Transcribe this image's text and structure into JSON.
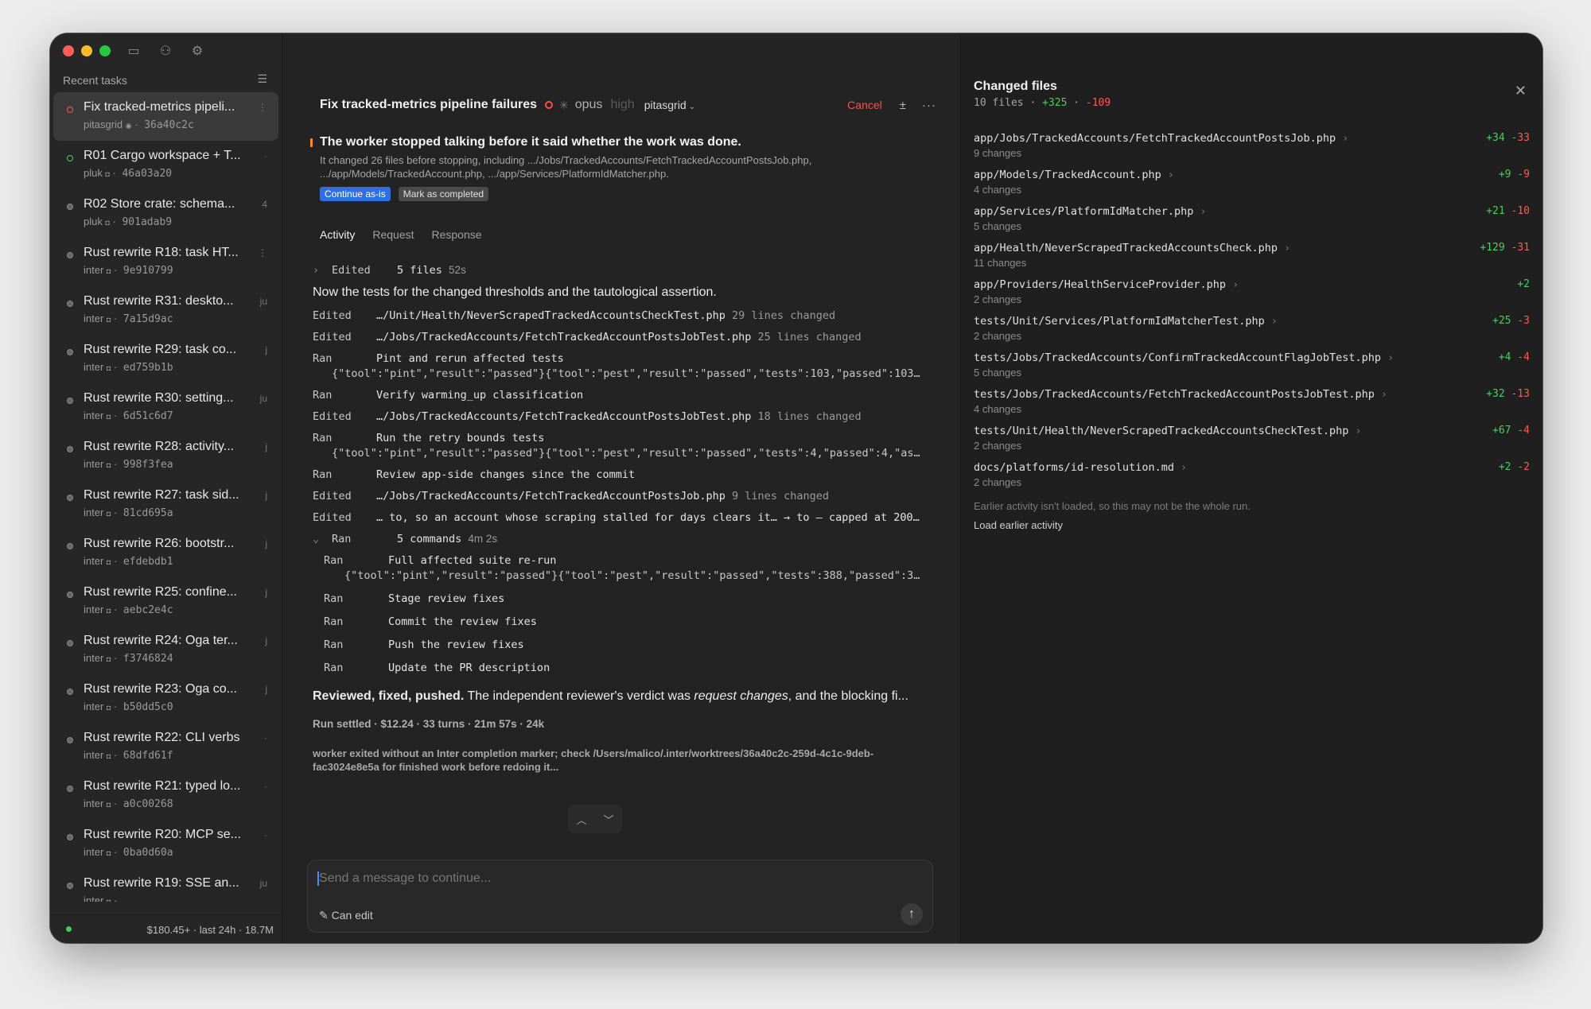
{
  "sidebar": {
    "recent_label": "Recent tasks",
    "tasks": [
      {
        "title": "Fix tracked-metrics pipeli...",
        "project": "pitasgrid",
        "hash": "36a40c2c",
        "status": "red",
        "right": "⋮",
        "icon": "◉"
      },
      {
        "title": "R01 Cargo workspace + T...",
        "project": "pluk",
        "hash": "46a03a20",
        "status": "green",
        "right": "·",
        "icon": "◘"
      },
      {
        "title": "R02 Store crate: schema...",
        "project": "pluk",
        "hash": "901adab9",
        "status": "gray",
        "right": "4",
        "icon": "◘"
      },
      {
        "title": "Rust rewrite R18: task HT...",
        "project": "inter",
        "hash": "9e910799",
        "status": "gray",
        "right": "⋮",
        "icon": "◘"
      },
      {
        "title": "Rust rewrite R31: deskto...",
        "project": "inter",
        "hash": "7a15d9ac",
        "status": "gray",
        "right": "ju",
        "icon": "◘"
      },
      {
        "title": "Rust rewrite R29: task co...",
        "project": "inter",
        "hash": "ed759b1b",
        "status": "gray",
        "right": "j",
        "icon": "◘"
      },
      {
        "title": "Rust rewrite R30: setting...",
        "project": "inter",
        "hash": "6d51c6d7",
        "status": "gray",
        "right": "ju",
        "icon": "◘"
      },
      {
        "title": "Rust rewrite R28: activity...",
        "project": "inter",
        "hash": "998f3fea",
        "status": "gray",
        "right": "j",
        "icon": "◘"
      },
      {
        "title": "Rust rewrite R27: task sid...",
        "project": "inter",
        "hash": "81cd695a",
        "status": "gray",
        "right": "j",
        "icon": "◘"
      },
      {
        "title": "Rust rewrite R26: bootstr...",
        "project": "inter",
        "hash": "efdebdb1",
        "status": "gray",
        "right": "j",
        "icon": "◘"
      },
      {
        "title": "Rust rewrite R25: confine...",
        "project": "inter",
        "hash": "aebc2e4c",
        "status": "gray",
        "right": "j",
        "icon": "◘"
      },
      {
        "title": "Rust rewrite R24: Oga ter...",
        "project": "inter",
        "hash": "f3746824",
        "status": "gray",
        "right": "j",
        "icon": "◘"
      },
      {
        "title": "Rust rewrite R23: Oga co...",
        "project": "inter",
        "hash": "b50dd5c0",
        "status": "gray",
        "right": "j",
        "icon": "◘"
      },
      {
        "title": "Rust rewrite R22: CLI verbs",
        "project": "inter",
        "hash": "68dfd61f",
        "status": "gray",
        "right": "·",
        "icon": "◘"
      },
      {
        "title": "Rust rewrite R21: typed lo...",
        "project": "inter",
        "hash": "a0c00268",
        "status": "gray",
        "right": "·",
        "icon": "◘"
      },
      {
        "title": "Rust rewrite R20: MCP se...",
        "project": "inter",
        "hash": "0ba0d60a",
        "status": "gray",
        "right": "·",
        "icon": "◘"
      },
      {
        "title": "Rust rewrite R19: SSE an...",
        "project": "inter",
        "hash": "",
        "status": "gray",
        "right": "ju",
        "icon": "◘"
      }
    ],
    "footer_cost": "$180.45+ · last 24h · 18.7M"
  },
  "main": {
    "title": "Fix tracked-metrics pipeline failures",
    "model": "opus",
    "effort": "high",
    "project": "pitasgrid",
    "cancel": "Cancel",
    "plusminus": "±",
    "more": "···",
    "alert_title": "The worker stopped talking before it said whether the work was done.",
    "alert_body": "It changed 26 files before stopping, including .../Jobs/TrackedAccounts/FetchTrackedAccountPostsJob.php, .../app/Models/TrackedAccount.php, .../app/Services/PlatformIdMatcher.php.",
    "continue_btn": "Continue as-is",
    "mark_btn": "Mark as completed",
    "tabs": [
      "Activity",
      "Request",
      "Response"
    ],
    "group1": {
      "kind": "Edited",
      "text": "5 files",
      "time": "52s"
    },
    "prose1": "Now the tests for the changed thresholds and the tautological assertion.",
    "rows": [
      {
        "kind": "Edited",
        "what": "…/Unit/Health/NeverScrapedTrackedAccountsCheckTest.php",
        "extra": "29 lines changed",
        "sub": ""
      },
      {
        "kind": "Edited",
        "what": "…/Jobs/TrackedAccounts/FetchTrackedAccountPostsJobTest.php",
        "extra": "25 lines changed",
        "sub": ""
      },
      {
        "kind": "Ran",
        "what": "Pint and rerun affected tests",
        "extra": "",
        "sub": "{\"tool\":\"pint\",\"result\":\"passed\"}{\"tool\":\"pest\",\"result\":\"passed\",\"tests\":103,\"passed\":103…"
      },
      {
        "kind": "Ran",
        "what": "Verify warming_up classification",
        "extra": "",
        "sub": ""
      },
      {
        "kind": "Edited",
        "what": "…/Jobs/TrackedAccounts/FetchTrackedAccountPostsJobTest.php",
        "extra": "18 lines changed",
        "sub": ""
      },
      {
        "kind": "Ran",
        "what": "Run the retry bounds tests",
        "extra": "",
        "sub": "{\"tool\":\"pint\",\"result\":\"passed\"}{\"tool\":\"pest\",\"result\":\"passed\",\"tests\":4,\"passed\":4,\"as…"
      },
      {
        "kind": "Ran",
        "what": "Review app-side changes since the commit",
        "extra": "",
        "sub": ""
      },
      {
        "kind": "Edited",
        "what": "…/Jobs/TrackedAccounts/FetchTrackedAccountPostsJob.php",
        "extra": "9 lines changed",
        "sub": ""
      },
      {
        "kind": "Edited",
        "what": "… to, so an account whose scraping stalled for days clears it… → to — capped at 200…",
        "extra": "",
        "sub": ""
      }
    ],
    "group2": {
      "kind": "Ran",
      "text": "5 commands",
      "time": "4m 2s"
    },
    "nested": [
      {
        "kind": "Ran",
        "what": "Full affected suite re-run",
        "sub": "{\"tool\":\"pint\",\"result\":\"passed\"}{\"tool\":\"pest\",\"result\":\"passed\",\"tests\":388,\"passed\":3…"
      },
      {
        "kind": "Ran",
        "what": "Stage review fixes",
        "sub": ""
      },
      {
        "kind": "Ran",
        "what": "Commit the review fixes",
        "sub": ""
      },
      {
        "kind": "Ran",
        "what": "Push the review fixes",
        "sub": ""
      },
      {
        "kind": "Ran",
        "what": "Update the PR description",
        "sub": ""
      }
    ],
    "prose2_bold": "Reviewed, fixed, pushed.",
    "prose2_a": " The independent reviewer's verdict was ",
    "prose2_em": "request changes",
    "prose2_b": ", and the blocking fi...",
    "run_settled": "Run settled · $12.24 · 33 turns · 21m 57s · 24k",
    "worker_note": "worker exited without an Inter completion marker; check /Users/malico/.inter/worktrees/36a40c2c-259d-4c1c-9deb-fac3024e8e5a for finished work before redoing it...",
    "composer_placeholder": "Send a message to continue...",
    "can_edit": "Can edit"
  },
  "changes": {
    "title": "Changed files",
    "count": "10 files",
    "plus": "+325",
    "minus": "-109",
    "files": [
      {
        "path": "app/Jobs/TrackedAccounts/FetchTrackedAccountPostsJob.php",
        "changes": "9 changes",
        "plus": "+34",
        "minus": "-33"
      },
      {
        "path": "app/Models/TrackedAccount.php",
        "changes": "4 changes",
        "plus": "+9",
        "minus": "-9"
      },
      {
        "path": "app/Services/PlatformIdMatcher.php",
        "changes": "5 changes",
        "plus": "+21",
        "minus": "-10"
      },
      {
        "path": "app/Health/NeverScrapedTrackedAccountsCheck.php",
        "changes": "11 changes",
        "plus": "+129",
        "minus": "-31"
      },
      {
        "path": "app/Providers/HealthServiceProvider.php",
        "changes": "2 changes",
        "plus": "+2",
        "minus": ""
      },
      {
        "path": "tests/Unit/Services/PlatformIdMatcherTest.php",
        "changes": "2 changes",
        "plus": "+25",
        "minus": "-3"
      },
      {
        "path": "tests/Jobs/TrackedAccounts/ConfirmTrackedAccountFlagJobTest.php",
        "changes": "5 changes",
        "plus": "+4",
        "minus": "-4"
      },
      {
        "path": "tests/Jobs/TrackedAccounts/FetchTrackedAccountPostsJobTest.php",
        "changes": "4 changes",
        "plus": "+32",
        "minus": "-13"
      },
      {
        "path": "tests/Unit/Health/NeverScrapedTrackedAccountsCheckTest.php",
        "changes": "2 changes",
        "plus": "+67",
        "minus": "-4"
      },
      {
        "path": "docs/platforms/id-resolution.md",
        "changes": "2 changes",
        "plus": "+2",
        "minus": "-2"
      }
    ],
    "earlier_note": "Earlier activity isn't loaded, so this may not be the whole run.",
    "load_earlier": "Load earlier activity"
  }
}
